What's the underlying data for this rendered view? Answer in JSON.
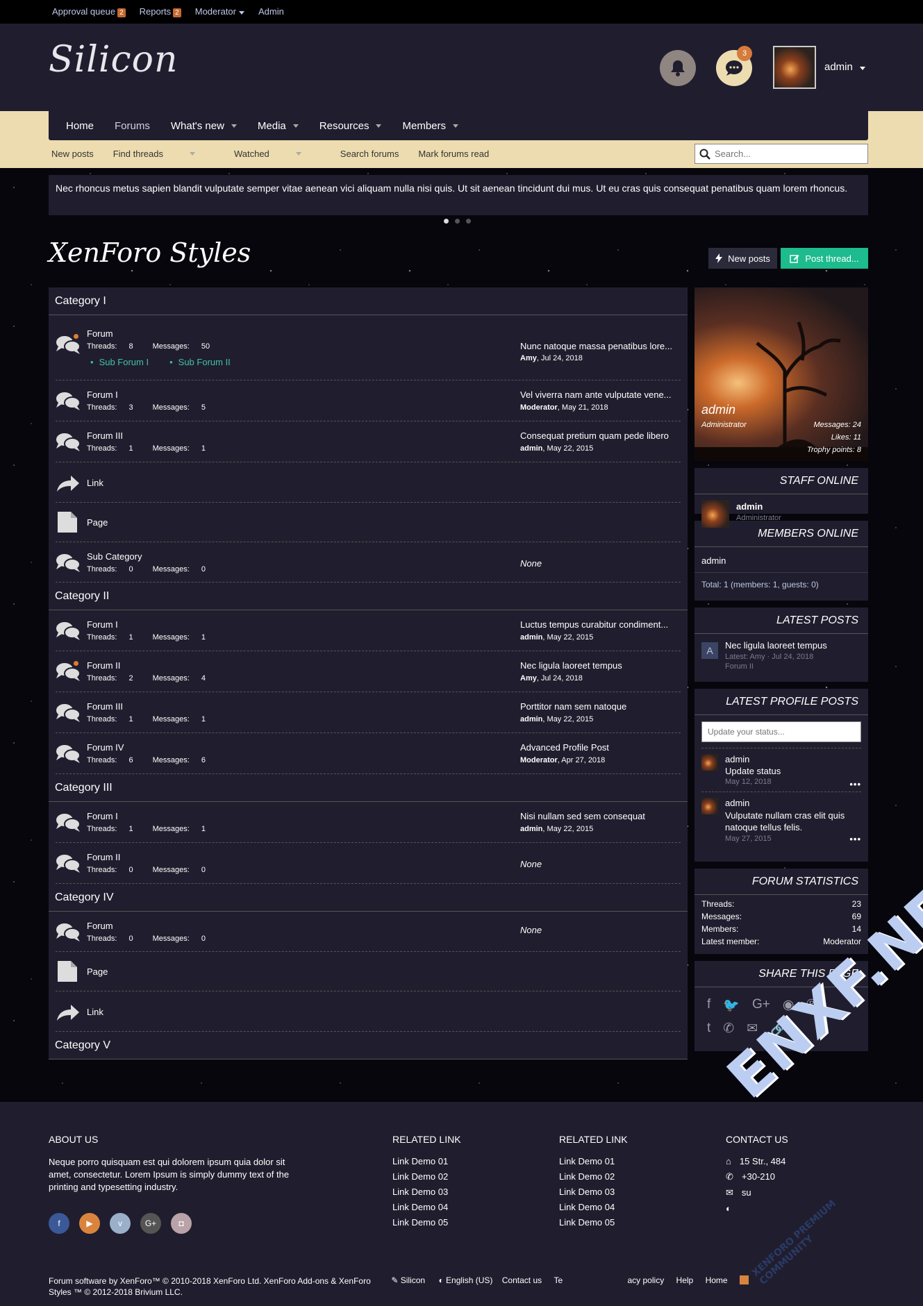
{
  "topbar": {
    "items": [
      {
        "label": "Approval queue",
        "badge": "2"
      },
      {
        "label": "Reports",
        "badge": "2"
      },
      {
        "label": "Moderator"
      },
      {
        "label": "Admin"
      }
    ]
  },
  "header": {
    "logo": "Silicon",
    "chat_badge": "3",
    "username": "admin"
  },
  "nav": {
    "tabs": [
      "Home",
      "Forums",
      "What's new",
      "Media",
      "Resources",
      "Members"
    ],
    "subnav": [
      "New posts",
      "Find threads",
      "Watched",
      "Search forums",
      "Mark forums read"
    ],
    "search_placeholder": "Search..."
  },
  "notice": "Nec rhoncus metus sapien blandit vulputate semper vitae aenean vici aliquam nulla nisi quis. Ut sit aenean tincidunt dui mus. Ut eu cras quis consequat penatibus quam lorem rhoncus.",
  "page": {
    "title": "XenForo Styles",
    "new_posts": "New posts",
    "post_thread": "Post thread..."
  },
  "labels": {
    "threads": "Threads:",
    "messages": "Messages:",
    "none": "None"
  },
  "categories": [
    {
      "name": "Category I",
      "rows": [
        {
          "name": "Forum",
          "threads": "8",
          "messages": "50",
          "last": "Nunc natoque massa penatibus lore...",
          "by": "Amy",
          "date": "Jul 24, 2018",
          "subforums": [
            "Sub Forum I",
            "Sub Forum II"
          ]
        },
        {
          "name": "Forum I",
          "threads": "3",
          "messages": "5",
          "last": "Vel viverra nam ante vulputate vene...",
          "by": "Moderator",
          "date": "May 21, 2018"
        },
        {
          "name": "Forum III",
          "threads": "1",
          "messages": "1",
          "last": "Consequat pretium quam pede libero",
          "by": "admin",
          "date": "May 22, 2015"
        },
        {
          "name": "Link"
        },
        {
          "name": "Page"
        },
        {
          "name": "Sub Category",
          "threads": "0",
          "messages": "0"
        }
      ]
    },
    {
      "name": "Category II",
      "rows": [
        {
          "name": "Forum I",
          "threads": "1",
          "messages": "1",
          "last": "Luctus tempus curabitur condiment...",
          "by": "admin",
          "date": "May 22, 2015"
        },
        {
          "name": "Forum II",
          "threads": "2",
          "messages": "4",
          "last": "Nec ligula laoreet tempus",
          "by": "Amy",
          "date": "Jul 24, 2018"
        },
        {
          "name": "Forum III",
          "threads": "1",
          "messages": "1",
          "last": "Porttitor nam sem natoque",
          "by": "admin",
          "date": "May 22, 2015"
        },
        {
          "name": "Forum IV",
          "threads": "6",
          "messages": "6",
          "last": "Advanced Profile Post",
          "by": "Moderator",
          "date": "Apr 27, 2018"
        }
      ]
    },
    {
      "name": "Category III",
      "rows": [
        {
          "name": "Forum I",
          "threads": "1",
          "messages": "1",
          "last": "Nisi nullam sed sem consequat",
          "by": "admin",
          "date": "May 22, 2015"
        },
        {
          "name": "Forum II",
          "threads": "0",
          "messages": "0"
        }
      ]
    },
    {
      "name": "Category IV",
      "rows": [
        {
          "name": "Forum",
          "threads": "0",
          "messages": "0"
        },
        {
          "name": "Page"
        },
        {
          "name": "Link"
        }
      ]
    },
    {
      "name": "Category V"
    }
  ],
  "sidebar": {
    "profile": {
      "name": "admin",
      "role": "Administrator",
      "messages": "Messages: 24",
      "likes": "Likes: 11",
      "trophy": "Trophy points: 8"
    },
    "staff": {
      "title": "STAFF ONLINE",
      "name": "admin",
      "role": "Administrator"
    },
    "members": {
      "title": "MEMBERS ONLINE",
      "name": "admin",
      "total": "Total: 1 (members: 1, guests: 0)"
    },
    "latest_posts": {
      "title": "LATEST POSTS",
      "avatar_letter": "A",
      "post": "Nec ligula laoreet tempus",
      "meta": "Latest: Amy · Jul 24, 2018",
      "forum": "Forum II"
    },
    "profile_posts": {
      "title": "LATEST PROFILE POSTS",
      "placeholder": "Update your status...",
      "items": [
        {
          "user": "admin",
          "text": "Update status",
          "date": "May 12, 2018"
        },
        {
          "user": "admin",
          "text": "Vulputate nullam cras elit quis natoque tellus felis.",
          "date": "May 27, 2015"
        }
      ]
    },
    "stats": {
      "title": "FORUM STATISTICS",
      "rows": [
        {
          "k": "Threads:",
          "v": "23"
        },
        {
          "k": "Messages:",
          "v": "69"
        },
        {
          "k": "Members:",
          "v": "14"
        },
        {
          "k": "Latest member:",
          "v": "Moderator"
        }
      ]
    },
    "share": {
      "title": "SHARE THIS PAGE",
      "icons_row1": [
        "f",
        "🐦",
        "G+",
        "◉",
        "℗"
      ],
      "icons_row2": [
        "t",
        "✆",
        "✉",
        "🔗"
      ]
    }
  },
  "footer": {
    "about_title": "ABOUT US",
    "about_text": "Neque porro quisquam est qui dolorem ipsum quia dolor sit amet, consectetur. Lorem Ipsum is simply dummy text of the printing and typesetting industry.",
    "rel1_title": "RELATED LINK",
    "rel2_title": "RELATED LINK",
    "links": [
      "Link Demo 01",
      "Link Demo 02",
      "Link Demo 03",
      "Link Demo 04",
      "Link Demo 05"
    ],
    "contact_title": "CONTACT US",
    "contact": [
      "15 Str., 484",
      "+30-210",
      "su",
      ""
    ],
    "social": [
      {
        "g": "f",
        "c": "#3b5998"
      },
      {
        "g": "▶",
        "c": "#d9843e"
      },
      {
        "g": "v",
        "c": "#9ab0c8"
      },
      {
        "g": "G+",
        "c": "#555"
      },
      {
        "g": "◘",
        "c": "#b9a2a8"
      }
    ],
    "copyright": "Forum software by XenForo™ © 2010-2018 XenForo Ltd. XenForo Add-ons & XenForo Styles ™ © 2012-2018 Brivium LLC.",
    "style_name": "Silicon",
    "language": "English (US)",
    "bottom_links": [
      "Contact us",
      "Te",
      "acy policy",
      "Help",
      "Home"
    ]
  },
  "watermark": {
    "main": "ENXF.NET",
    "sub": "XENFORO PREMIUM COMMUNITY"
  },
  "colors": {
    "accent_green": "#1dbb8d",
    "accent_orange": "#d9843e",
    "panel": "#201e2e",
    "nav_beige": "#ecdcb0",
    "link_teal": "#3fc3a6"
  }
}
